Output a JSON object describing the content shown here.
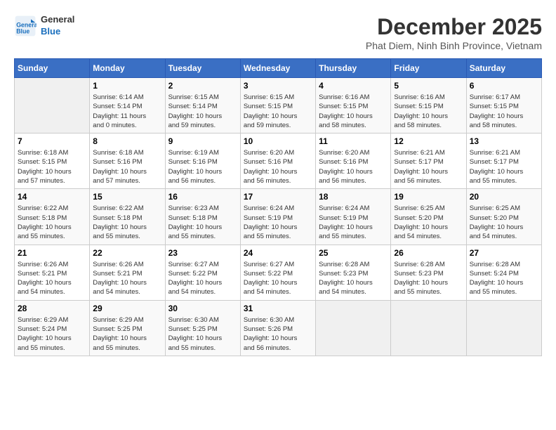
{
  "header": {
    "logo_line1": "General",
    "logo_line2": "Blue",
    "month_title": "December 2025",
    "subtitle": "Phat Diem, Ninh Binh Province, Vietnam"
  },
  "calendar": {
    "days_of_week": [
      "Sunday",
      "Monday",
      "Tuesday",
      "Wednesday",
      "Thursday",
      "Friday",
      "Saturday"
    ],
    "weeks": [
      [
        {
          "day": "",
          "info": ""
        },
        {
          "day": "1",
          "info": "Sunrise: 6:14 AM\nSunset: 5:14 PM\nDaylight: 11 hours\nand 0 minutes."
        },
        {
          "day": "2",
          "info": "Sunrise: 6:15 AM\nSunset: 5:14 PM\nDaylight: 10 hours\nand 59 minutes."
        },
        {
          "day": "3",
          "info": "Sunrise: 6:15 AM\nSunset: 5:15 PM\nDaylight: 10 hours\nand 59 minutes."
        },
        {
          "day": "4",
          "info": "Sunrise: 6:16 AM\nSunset: 5:15 PM\nDaylight: 10 hours\nand 58 minutes."
        },
        {
          "day": "5",
          "info": "Sunrise: 6:16 AM\nSunset: 5:15 PM\nDaylight: 10 hours\nand 58 minutes."
        },
        {
          "day": "6",
          "info": "Sunrise: 6:17 AM\nSunset: 5:15 PM\nDaylight: 10 hours\nand 58 minutes."
        }
      ],
      [
        {
          "day": "7",
          "info": "Sunrise: 6:18 AM\nSunset: 5:15 PM\nDaylight: 10 hours\nand 57 minutes."
        },
        {
          "day": "8",
          "info": "Sunrise: 6:18 AM\nSunset: 5:16 PM\nDaylight: 10 hours\nand 57 minutes."
        },
        {
          "day": "9",
          "info": "Sunrise: 6:19 AM\nSunset: 5:16 PM\nDaylight: 10 hours\nand 56 minutes."
        },
        {
          "day": "10",
          "info": "Sunrise: 6:20 AM\nSunset: 5:16 PM\nDaylight: 10 hours\nand 56 minutes."
        },
        {
          "day": "11",
          "info": "Sunrise: 6:20 AM\nSunset: 5:16 PM\nDaylight: 10 hours\nand 56 minutes."
        },
        {
          "day": "12",
          "info": "Sunrise: 6:21 AM\nSunset: 5:17 PM\nDaylight: 10 hours\nand 56 minutes."
        },
        {
          "day": "13",
          "info": "Sunrise: 6:21 AM\nSunset: 5:17 PM\nDaylight: 10 hours\nand 55 minutes."
        }
      ],
      [
        {
          "day": "14",
          "info": "Sunrise: 6:22 AM\nSunset: 5:18 PM\nDaylight: 10 hours\nand 55 minutes."
        },
        {
          "day": "15",
          "info": "Sunrise: 6:22 AM\nSunset: 5:18 PM\nDaylight: 10 hours\nand 55 minutes."
        },
        {
          "day": "16",
          "info": "Sunrise: 6:23 AM\nSunset: 5:18 PM\nDaylight: 10 hours\nand 55 minutes."
        },
        {
          "day": "17",
          "info": "Sunrise: 6:24 AM\nSunset: 5:19 PM\nDaylight: 10 hours\nand 55 minutes."
        },
        {
          "day": "18",
          "info": "Sunrise: 6:24 AM\nSunset: 5:19 PM\nDaylight: 10 hours\nand 55 minutes."
        },
        {
          "day": "19",
          "info": "Sunrise: 6:25 AM\nSunset: 5:20 PM\nDaylight: 10 hours\nand 54 minutes."
        },
        {
          "day": "20",
          "info": "Sunrise: 6:25 AM\nSunset: 5:20 PM\nDaylight: 10 hours\nand 54 minutes."
        }
      ],
      [
        {
          "day": "21",
          "info": "Sunrise: 6:26 AM\nSunset: 5:21 PM\nDaylight: 10 hours\nand 54 minutes."
        },
        {
          "day": "22",
          "info": "Sunrise: 6:26 AM\nSunset: 5:21 PM\nDaylight: 10 hours\nand 54 minutes."
        },
        {
          "day": "23",
          "info": "Sunrise: 6:27 AM\nSunset: 5:22 PM\nDaylight: 10 hours\nand 54 minutes."
        },
        {
          "day": "24",
          "info": "Sunrise: 6:27 AM\nSunset: 5:22 PM\nDaylight: 10 hours\nand 54 minutes."
        },
        {
          "day": "25",
          "info": "Sunrise: 6:28 AM\nSunset: 5:23 PM\nDaylight: 10 hours\nand 54 minutes."
        },
        {
          "day": "26",
          "info": "Sunrise: 6:28 AM\nSunset: 5:23 PM\nDaylight: 10 hours\nand 55 minutes."
        },
        {
          "day": "27",
          "info": "Sunrise: 6:28 AM\nSunset: 5:24 PM\nDaylight: 10 hours\nand 55 minutes."
        }
      ],
      [
        {
          "day": "28",
          "info": "Sunrise: 6:29 AM\nSunset: 5:24 PM\nDaylight: 10 hours\nand 55 minutes."
        },
        {
          "day": "29",
          "info": "Sunrise: 6:29 AM\nSunset: 5:25 PM\nDaylight: 10 hours\nand 55 minutes."
        },
        {
          "day": "30",
          "info": "Sunrise: 6:30 AM\nSunset: 5:25 PM\nDaylight: 10 hours\nand 55 minutes."
        },
        {
          "day": "31",
          "info": "Sunrise: 6:30 AM\nSunset: 5:26 PM\nDaylight: 10 hours\nand 56 minutes."
        },
        {
          "day": "",
          "info": ""
        },
        {
          "day": "",
          "info": ""
        },
        {
          "day": "",
          "info": ""
        }
      ]
    ]
  }
}
